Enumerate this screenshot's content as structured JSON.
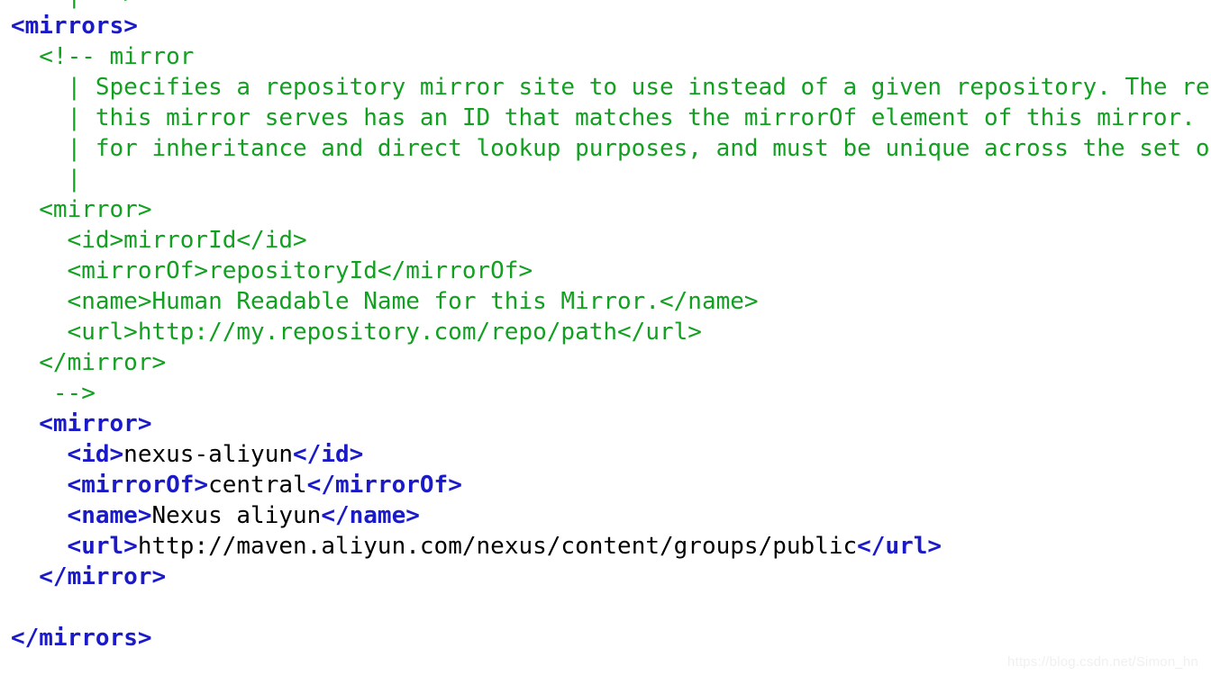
{
  "document": {
    "language": "xml",
    "background_color": "#ffffff",
    "colors": {
      "tag": "#1a1ac8",
      "text": "#000000",
      "comment": "#12a021",
      "watermark": "#f0f0f0"
    },
    "lines": [
      {
        "indent": 4,
        "clipped_top": true,
        "tokens": [
          {
            "type": "comment",
            "value": "| -->"
          }
        ]
      },
      {
        "indent": 0,
        "tokens": [
          {
            "type": "tag",
            "value": "<mirrors>"
          }
        ]
      },
      {
        "indent": 2,
        "tokens": [
          {
            "type": "comment",
            "value": "<!-- mirror"
          }
        ]
      },
      {
        "indent": 4,
        "clipped_right": true,
        "tokens": [
          {
            "type": "comment",
            "value": "| Specifies a repository mirror site to use instead of a given repository. The repository that"
          }
        ]
      },
      {
        "indent": 4,
        "clipped_right": true,
        "tokens": [
          {
            "type": "comment",
            "value": "| this mirror serves has an ID that matches the mirrorOf element of this mirror. IDs are used"
          }
        ]
      },
      {
        "indent": 4,
        "clipped_right": true,
        "tokens": [
          {
            "type": "comment",
            "value": "| for inheritance and direct lookup purposes, and must be unique across the set of mirrors."
          }
        ]
      },
      {
        "indent": 4,
        "tokens": [
          {
            "type": "comment",
            "value": "|"
          }
        ]
      },
      {
        "indent": 2,
        "tokens": [
          {
            "type": "comment",
            "value": "<mirror>"
          }
        ]
      },
      {
        "indent": 4,
        "tokens": [
          {
            "type": "comment",
            "value": "<id>mirrorId</id>"
          }
        ]
      },
      {
        "indent": 4,
        "tokens": [
          {
            "type": "comment",
            "value": "<mirrorOf>repositoryId</mirrorOf>"
          }
        ]
      },
      {
        "indent": 4,
        "tokens": [
          {
            "type": "comment",
            "value": "<name>Human Readable Name for this Mirror.</name>"
          }
        ]
      },
      {
        "indent": 4,
        "tokens": [
          {
            "type": "comment",
            "value": "<url>http://my.repository.com/repo/path</url>"
          }
        ]
      },
      {
        "indent": 2,
        "tokens": [
          {
            "type": "comment",
            "value": "</mirror>"
          }
        ]
      },
      {
        "indent": 3,
        "tokens": [
          {
            "type": "comment",
            "value": "-->"
          }
        ]
      },
      {
        "indent": 2,
        "tokens": [
          {
            "type": "tag",
            "value": "<mirror>"
          }
        ]
      },
      {
        "indent": 4,
        "tokens": [
          {
            "type": "tag",
            "value": "<id>"
          },
          {
            "type": "text",
            "value": "nexus-aliyun"
          },
          {
            "type": "tag",
            "value": "</id>"
          }
        ]
      },
      {
        "indent": 4,
        "tokens": [
          {
            "type": "tag",
            "value": "<mirrorOf>"
          },
          {
            "type": "text",
            "value": "central"
          },
          {
            "type": "tag",
            "value": "</mirrorOf>"
          }
        ]
      },
      {
        "indent": 4,
        "tokens": [
          {
            "type": "tag",
            "value": "<name>"
          },
          {
            "type": "text",
            "value": "Nexus aliyun"
          },
          {
            "type": "tag",
            "value": "</name>"
          }
        ]
      },
      {
        "indent": 4,
        "tokens": [
          {
            "type": "tag",
            "value": "<url>"
          },
          {
            "type": "text",
            "value": "http://maven.aliyun.com/nexus/content/groups/public"
          },
          {
            "type": "tag",
            "value": "</url>"
          }
        ]
      },
      {
        "indent": 2,
        "tokens": [
          {
            "type": "tag",
            "value": "</mirror>"
          }
        ]
      },
      {
        "indent": 0,
        "blank": true,
        "tokens": []
      },
      {
        "indent": 0,
        "tokens": [
          {
            "type": "tag",
            "value": "</mirrors>"
          }
        ]
      }
    ]
  },
  "watermark": {
    "text": "https://blog.csdn.net/Simon_hn"
  }
}
